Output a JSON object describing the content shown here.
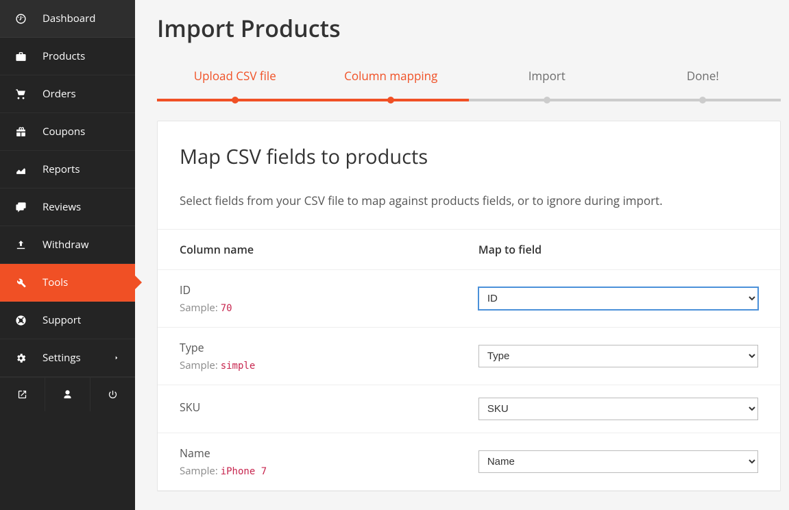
{
  "sidebar": {
    "items": [
      {
        "key": "dashboard",
        "label": "Dashboard",
        "icon": "dashboard-icon"
      },
      {
        "key": "products",
        "label": "Products",
        "icon": "briefcase-icon"
      },
      {
        "key": "orders",
        "label": "Orders",
        "icon": "cart-icon"
      },
      {
        "key": "coupons",
        "label": "Coupons",
        "icon": "gift-icon"
      },
      {
        "key": "reports",
        "label": "Reports",
        "icon": "chart-icon"
      },
      {
        "key": "reviews",
        "label": "Reviews",
        "icon": "comments-icon"
      },
      {
        "key": "withdraw",
        "label": "Withdraw",
        "icon": "upload-icon"
      },
      {
        "key": "tools",
        "label": "Tools",
        "icon": "wrench-icon"
      },
      {
        "key": "support",
        "label": "Support",
        "icon": "lifebuoy-icon"
      },
      {
        "key": "settings",
        "label": "Settings",
        "icon": "gear-icon",
        "chevron": true
      }
    ],
    "active": "tools"
  },
  "page": {
    "title": "Import Products"
  },
  "stepper": {
    "steps": [
      {
        "label": "Upload CSV file",
        "active": true
      },
      {
        "label": "Column mapping",
        "active": true
      },
      {
        "label": "Import",
        "active": false
      },
      {
        "label": "Done!",
        "active": false
      }
    ]
  },
  "card": {
    "title": "Map CSV fields to products",
    "description": "Select fields from your CSV file to map against products fields, or to ignore during import.",
    "columns": {
      "name": "Column name",
      "field": "Map to field"
    },
    "sample_label": "Sample:",
    "rows": [
      {
        "name": "ID",
        "sample": "70",
        "mapped": "ID",
        "focused": true
      },
      {
        "name": "Type",
        "sample": "simple",
        "mapped": "Type",
        "focused": false
      },
      {
        "name": "SKU",
        "sample": "",
        "mapped": "SKU",
        "focused": false
      },
      {
        "name": "Name",
        "sample": "iPhone 7",
        "mapped": "Name",
        "focused": false
      }
    ]
  }
}
